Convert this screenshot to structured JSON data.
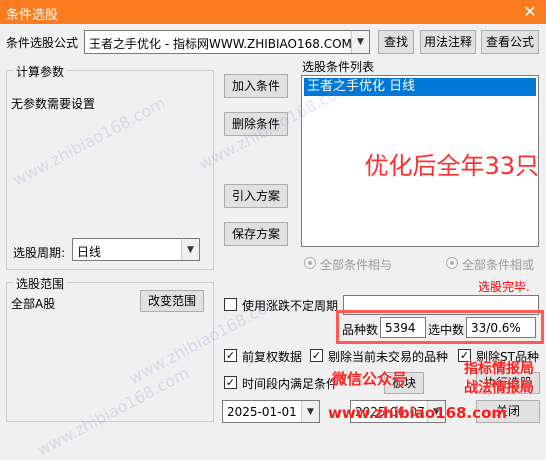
{
  "title": "条件选股",
  "header": {
    "label": "条件选股公式",
    "formula": "王者之手优化 - 指标网WWW.ZHIBIAO168.COM",
    "btn_find": "查找",
    "btn_usage": "用法注释",
    "btn_view": "查看公式"
  },
  "params": {
    "legend": "计算参数",
    "text": "无参数需要设置",
    "period_label": "选股周期:",
    "period_value": "日线"
  },
  "middle": {
    "add": "加入条件",
    "delete": "删除条件",
    "import": "引入方案",
    "save": "保存方案"
  },
  "conditions": {
    "label": "选股条件列表",
    "items": [
      "王者之手优化  日线"
    ],
    "overlay": "优化后全年33只",
    "radio_and": "全部条件相与",
    "radio_or": "全部条件相或"
  },
  "range": {
    "legend": "选股范围",
    "value": "全部A股",
    "change": "改变范围"
  },
  "status": {
    "done": "选股完毕.",
    "use_period": "使用涨跌不定周期",
    "count_label": "品种数",
    "count_value": "5394",
    "selected_label": "选中数",
    "selected_value": "33/0.6%"
  },
  "options": {
    "pre_adjust": "前复权数据",
    "exclude_untraded": "剔除当前未交易的品种",
    "exclude_st": "剔除ST品种",
    "time_range": "时间段内满足条件",
    "board": "板块",
    "start_date": "2025-01-01",
    "end_date": "2025-06-07"
  },
  "actions": {
    "run": "执行选股",
    "close": "关闭"
  },
  "overlay_labels": {
    "wechat": "微信公众号",
    "line1": "指标情报局",
    "line2": "战法情报局",
    "site": "www.zhibiao168.com"
  },
  "watermark": "www.zhibiao168.com",
  "colors": {
    "titlebar": "#fb7c1e",
    "selection": "#0078d7",
    "overlay_red": "#ff2d2d",
    "highlight_box": "#ff5a5a"
  }
}
